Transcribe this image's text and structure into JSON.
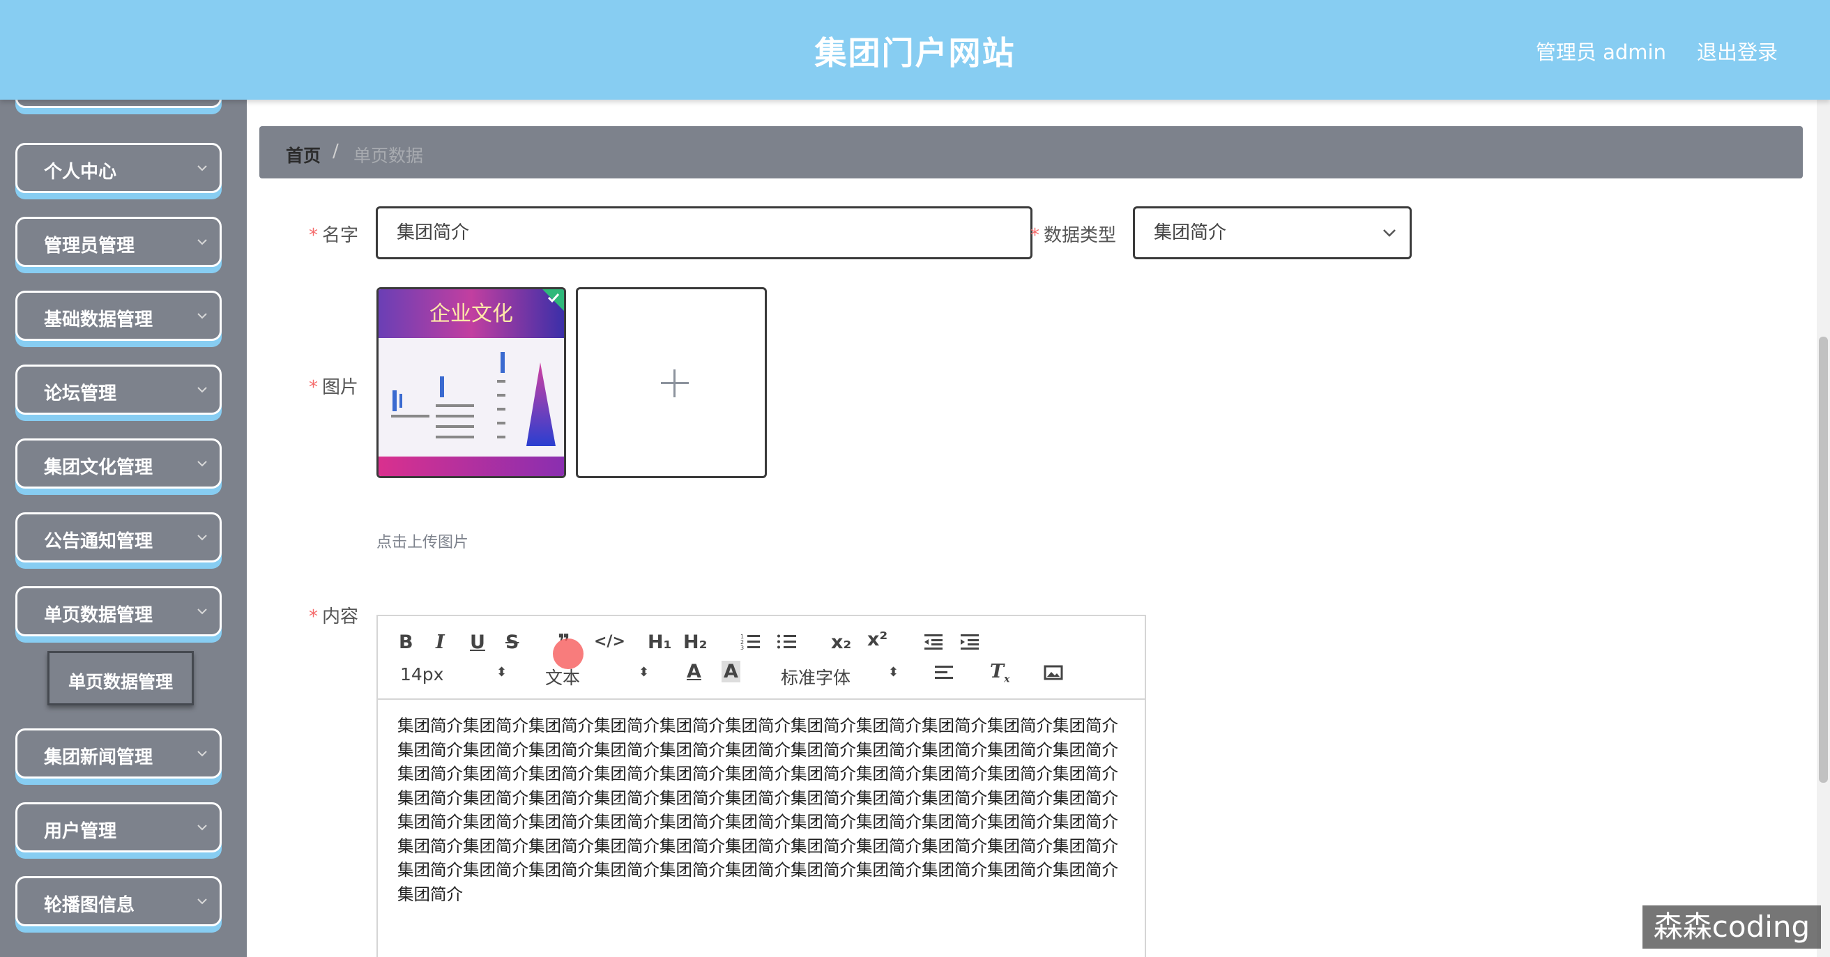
{
  "header": {
    "title": "集团门户网站",
    "user": "管理员 admin",
    "logout": "退出登录"
  },
  "sidebar": {
    "items": [
      {
        "label": "个人中心"
      },
      {
        "label": "管理员管理"
      },
      {
        "label": "基础数据管理"
      },
      {
        "label": "论坛管理"
      },
      {
        "label": "集团文化管理"
      },
      {
        "label": "公告通知管理"
      },
      {
        "label": "单页数据管理"
      },
      {
        "label": "集团新闻管理"
      },
      {
        "label": "用户管理"
      },
      {
        "label": "轮播图信息"
      }
    ],
    "active_subitem": "单页数据管理"
  },
  "breadcrumb": {
    "home": "首页",
    "separator": "/",
    "current": "单页数据"
  },
  "form": {
    "name_label": "名字",
    "name_value": "集团简介",
    "type_label": "数据类型",
    "type_value": "集团简介",
    "image_label": "图片",
    "upload_tip": "点击上传图片",
    "content_label": "内容",
    "required_mark": "*"
  },
  "editor": {
    "font_size": "14px",
    "text_type": "文本",
    "font_family": "标准字体",
    "content": "集团简介集团简介集团简介集团简介集团简介集团简介集团简介集团简介集团简介集团简介集团简介集团简介集团简介集团简介集团简介集团简介集团简介集团简介集团简介集团简介集团简介集团简介集团简介集团简介集团简介集团简介集团简介集团简介集团简介集团简介集团简介集团简介集团简介集团简介集团简介集团简介集团简介集团简介集团简介集团简介集团简介集团简介集团简介集团简介集团简介集团简介集团简介集团简介集团简介集团简介集团简介集团简介集团简介集团简介集团简介集团简介集团简介集团简介集团简介集团简介集团简介集团简介集团简介集团简介集团简介集团简介集团简介集团简介集团简介集团简介集团简介集团简介集团简介集团简介集团简介集团简介集团简介集团简介"
  },
  "thumbnail": {
    "title_text": "企业文化"
  },
  "watermark": "森森coding"
}
